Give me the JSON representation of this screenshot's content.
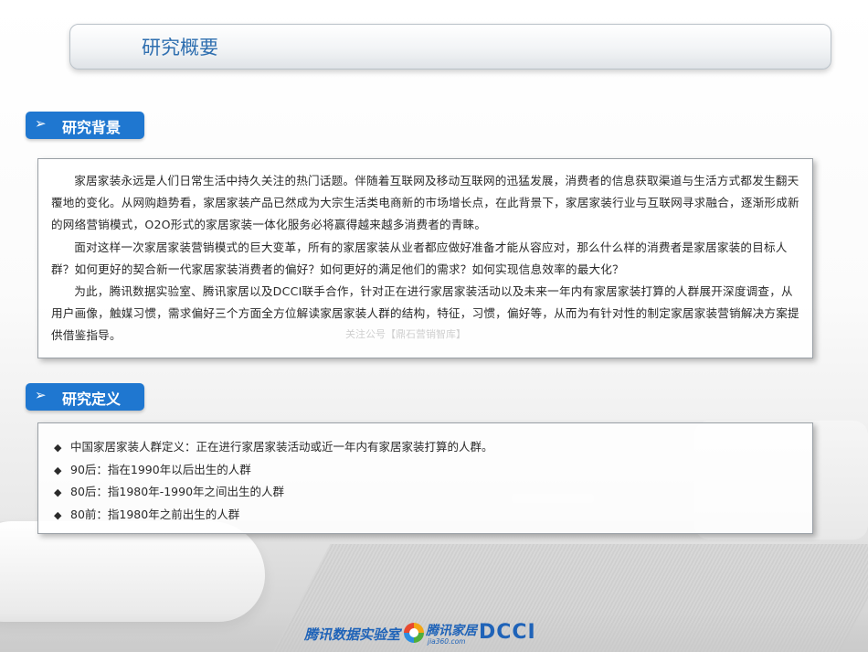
{
  "header": {
    "title": "研究概要"
  },
  "background_section": {
    "label": "研究背景",
    "paragraphs": [
      "家居家装永远是人们日常生活中持久关注的热门话题。伴随着互联网及移动互联网的迅猛发展，消费者的信息获取渠道与生活方式都发生翻天覆地的变化。从网购趋势看，家居家装产品已然成为大宗生活类电商新的市场增长点，在此背景下，家居家装行业与互联网寻求融合，逐渐形成新的网络营销模式，O2O形式的家居家装一体化服务必将赢得越来越多消费者的青睐。",
      "面对这样一次家居家装营销模式的巨大变革，所有的家居家装从业者都应做好准备才能从容应对，那么什么样的消费者是家居家装的目标人群？如何更好的契合新一代家居家装消费者的偏好？如何更好的满足他们的需求？如何实现信息效率的最大化？",
      "为此，腾讯数据实验室、腾讯家居以及DCCI联手合作，针对正在进行家居家装活动以及未来一年内有家居家装打算的人群展开深度调查，从用户画像，触媒习惯，需求偏好三个方面全方位解读家居家装人群的结构，特征，习惯，偏好等，从而为有针对性的制定家居家装营销解决方案提供借鉴指导。"
    ]
  },
  "definition_section": {
    "label": "研究定义",
    "items": [
      "中国家居家装人群定义：正在进行家居家装活动或近一年内有家居家装打算的人群。",
      "90后：指在1990年以后出生的人群",
      "80后：指1980年-1990年之间出生的人群",
      "80前：指1980年之前出生的人群"
    ]
  },
  "icons": {
    "section_arrow": "➢",
    "bullet": "◆"
  },
  "watermark": "关注公号【鼎石营销智库】",
  "footer": {
    "logo_tencent_data_lab": "腾讯数据实验室",
    "logo_tencent_home": "腾讯家居",
    "logo_tencent_home_domain": "jia360.com",
    "logo_dcci": "DCCI"
  },
  "colors": {
    "accent": "#1f77d0",
    "title_text": "#2f6fb0",
    "logo": "#1f63b8"
  }
}
